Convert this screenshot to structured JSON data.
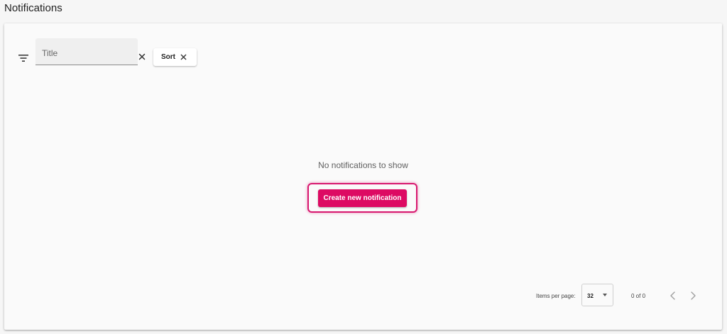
{
  "page": {
    "title": "Notifications"
  },
  "filter": {
    "title_placeholder": "Title",
    "title_value": "",
    "sort_label": "Sort"
  },
  "empty_state": {
    "message": "No notifications to show",
    "create_button_label": "Create new notification"
  },
  "pagination": {
    "items_per_page_label": "Items per page:",
    "items_per_page_value": "32",
    "range_label": "0 of 0"
  },
  "colors": {
    "accent": "#dd0a63",
    "focus_ring": "#d8186f",
    "background": "#f6f6f6",
    "card": "#fafafa"
  },
  "icons": {
    "filter": "filter-list-icon",
    "clear": "close-icon",
    "sort_remove": "close-icon",
    "prev": "chevron-left-icon",
    "next": "chevron-right-icon",
    "dropdown": "caret-down-icon"
  }
}
